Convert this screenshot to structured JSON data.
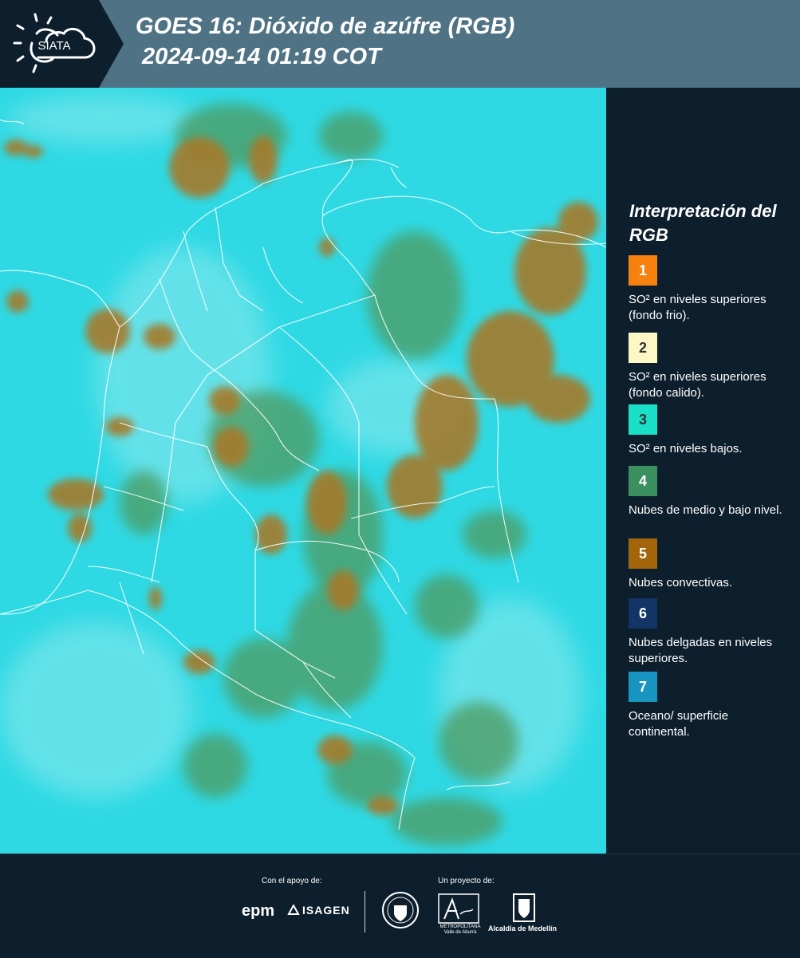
{
  "header": {
    "logo_text": "SIATA",
    "title_line1": "GOES 16: Dióxido de azúfre (RGB)",
    "title_line2": "2024-09-14 01:19 COT"
  },
  "legend": {
    "title": "Interpretación del RGB",
    "items": [
      {
        "num": "1",
        "label": "SO² en niveles superiores (fondo frio).",
        "color": "#f7810f"
      },
      {
        "num": "2",
        "label": "SO² en niveles superiores (fondo calido).",
        "color": "#fdf7c6"
      },
      {
        "num": "3",
        "label": "SO² en niveles bajos.",
        "color": "#1be0c8"
      },
      {
        "num": "4",
        "label": "Nubes de medio y bajo nivel.",
        "color": "#3c9060"
      },
      {
        "num": "5",
        "label": "Nubes convectivas.",
        "color": "#a2650a"
      },
      {
        "num": "6",
        "label": "Nubes delgadas en niveles superiores.",
        "color": "#123466"
      },
      {
        "num": "7",
        "label": "Oceano/ superficie continental.",
        "color": "#1894c0"
      }
    ]
  },
  "footer": {
    "support_label": "Con el apoyo de:",
    "project_label": "Un proyecto de:",
    "epm": "epm",
    "isagen": "ISAGEN",
    "area_line1": "METROPOLITANA",
    "area_line2": "Valle de Aburrá",
    "alcaldia": "Alcaldía de Medellín"
  },
  "colors": {
    "background": "#0d1f2d",
    "header_band": "#4f7384",
    "map_base": "#2ed9e4",
    "convective": "#a57a2a",
    "mid_cloud": "#4f9a5e",
    "borders": "#ffffff"
  }
}
